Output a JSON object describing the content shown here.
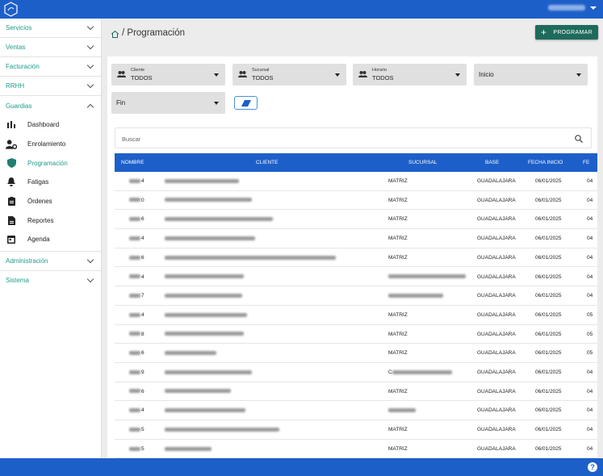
{
  "header": {
    "page_title": "Programación",
    "program_button": "PROGRAMAR",
    "separator": "/"
  },
  "sidebar": {
    "sections_top": [
      "Servicios",
      "Ventas",
      "Facturación",
      "RRHH"
    ],
    "expanded_section": "Guardias",
    "sub_items": [
      {
        "label": "Dashboard",
        "icon": "bar-chart-icon",
        "active": false
      },
      {
        "label": "Enrolamiento",
        "icon": "user-gear-icon",
        "active": false
      },
      {
        "label": "Programación",
        "icon": "shield-icon",
        "active": true
      },
      {
        "label": "Fatigas",
        "icon": "alarm-icon",
        "active": false
      },
      {
        "label": "Órdenes",
        "icon": "clipboard-icon",
        "active": false
      },
      {
        "label": "Reportes",
        "icon": "document-icon",
        "active": false
      },
      {
        "label": "Agenda",
        "icon": "calendar-icon",
        "active": false
      }
    ],
    "sections_bottom": [
      "Administración",
      "Sistema"
    ]
  },
  "filters": {
    "cliente": {
      "label": "Cliente",
      "value": "TODOS"
    },
    "sucursal": {
      "label": "Sucursal",
      "value": "TODOS"
    },
    "horario": {
      "label": "Horario",
      "value": "TODOS"
    },
    "inicio": {
      "value": "Inicio"
    },
    "fin": {
      "value": "Fin"
    }
  },
  "search": {
    "placeholder": "Buscar"
  },
  "table": {
    "headers": [
      "NOMBRE",
      "CLIENTE",
      "SUCURSAL",
      "BASE",
      "FECHA INICIO",
      "FE"
    ],
    "rows": [
      {
        "nombre": "4",
        "sucursal": "MATRIZ",
        "base": "GUADALAJARA",
        "fecha_inicio": "06/01/2025",
        "fecha_fin": "04"
      },
      {
        "nombre": "0",
        "sucursal": "MATRIZ",
        "base": "GUADALAJARA",
        "fecha_inicio": "06/01/2025",
        "fecha_fin": "04"
      },
      {
        "nombre": "6",
        "sucursal": "MATRIZ",
        "base": "GUADALAJARA",
        "fecha_inicio": "06/01/2025",
        "fecha_fin": "04"
      },
      {
        "nombre": "4",
        "sucursal": "MATRIZ",
        "base": "GUADALAJARA",
        "fecha_inicio": "06/01/2025",
        "fecha_fin": "04"
      },
      {
        "nombre": "6",
        "sucursal": "MATRIZ",
        "base": "GUADALAJARA",
        "fecha_inicio": "06/01/2025",
        "fecha_fin": "04"
      },
      {
        "nombre": "4",
        "sucursal": "",
        "base": "GUADALAJARA",
        "fecha_inicio": "06/01/2025",
        "fecha_fin": "04"
      },
      {
        "nombre": "7",
        "sucursal": "",
        "base": "GUADALAJARA",
        "fecha_inicio": "06/01/2025",
        "fecha_fin": "04"
      },
      {
        "nombre": "4",
        "sucursal": "MATRIZ",
        "base": "GUADALAJARA",
        "fecha_inicio": "06/01/2025",
        "fecha_fin": "05"
      },
      {
        "nombre": "8",
        "sucursal": "MATRIZ",
        "base": "GUADALAJARA",
        "fecha_inicio": "06/01/2025",
        "fecha_fin": "05"
      },
      {
        "nombre": "6",
        "sucursal": "MATRIZ",
        "base": "GUADALAJARA",
        "fecha_inicio": "06/01/2025",
        "fecha_fin": "05"
      },
      {
        "nombre": "9",
        "sucursal": "C",
        "base": "GUADALAJARA",
        "fecha_inicio": "06/01/2025",
        "fecha_fin": "04"
      },
      {
        "nombre": "6",
        "sucursal": "MATRIZ",
        "base": "GUADALAJARA",
        "fecha_inicio": "06/01/2025",
        "fecha_fin": "04"
      },
      {
        "nombre": "4",
        "sucursal": "",
        "base": "GUADALAJARA",
        "fecha_inicio": "06/01/2025",
        "fecha_fin": "04"
      },
      {
        "nombre": "5",
        "sucursal": "MATRIZ",
        "base": "GUADALAJARA",
        "fecha_inicio": "06/01/2025",
        "fecha_fin": "04"
      },
      {
        "nombre": "5",
        "sucursal": "MATRIZ",
        "base": "GUADALAJARA",
        "fecha_inicio": "06/01/2025",
        "fecha_fin": "04"
      }
    ]
  },
  "colors": {
    "primary": "#1d5fc9",
    "accent": "#1f9c8a",
    "button": "#1e6a5b"
  },
  "help": {
    "label": "?"
  }
}
